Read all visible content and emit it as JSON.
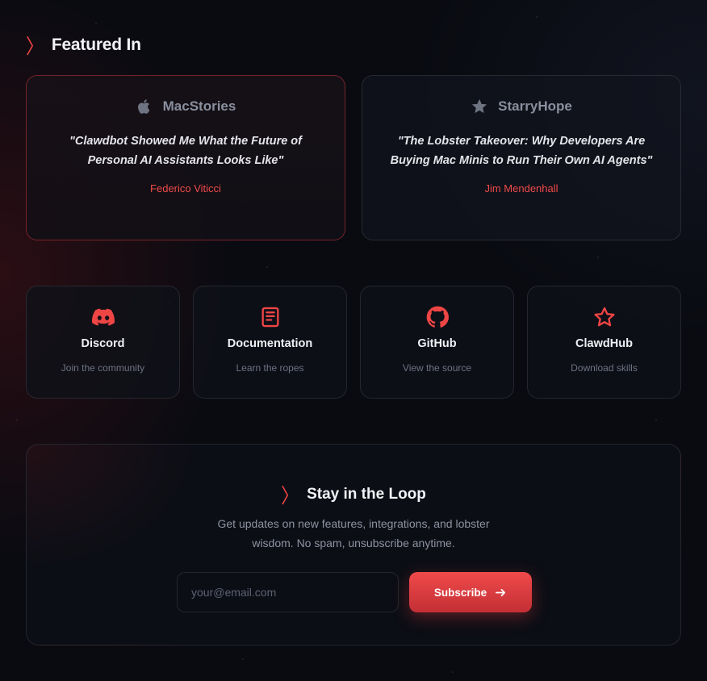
{
  "colors": {
    "accent": "#ee4545",
    "background": "#090b11",
    "card_bg": "#11141d",
    "muted_text": "#8e93a2"
  },
  "featured": {
    "title": "Featured In",
    "items": [
      {
        "publication": "MacStories",
        "icon": "apple-icon",
        "quote": "\"Clawdbot Showed Me What the Future of Personal AI Assistants Looks Like\"",
        "author": "Federico Viticci"
      },
      {
        "publication": "StarryHope",
        "icon": "star-icon",
        "quote": "\"The Lobster Takeover: Why Developers Are Buying Mac Minis to Run Their Own AI Agents\"",
        "author": "Jim Mendenhall"
      }
    ]
  },
  "links": [
    {
      "title": "Discord",
      "subtitle": "Join the community",
      "icon": "discord-icon"
    },
    {
      "title": "Documentation",
      "subtitle": "Learn the ropes",
      "icon": "book-icon"
    },
    {
      "title": "GitHub",
      "subtitle": "View the source",
      "icon": "github-icon"
    },
    {
      "title": "ClawdHub",
      "subtitle": "Download skills",
      "icon": "star-outline-icon"
    }
  ],
  "newsletter": {
    "title": "Stay in the Loop",
    "description_line1": "Get updates on new features, integrations, and lobster",
    "description_line2": "wisdom. No spam, unsubscribe anytime.",
    "email_placeholder": "your@email.com",
    "email_value": "",
    "button_label": "Subscribe"
  }
}
